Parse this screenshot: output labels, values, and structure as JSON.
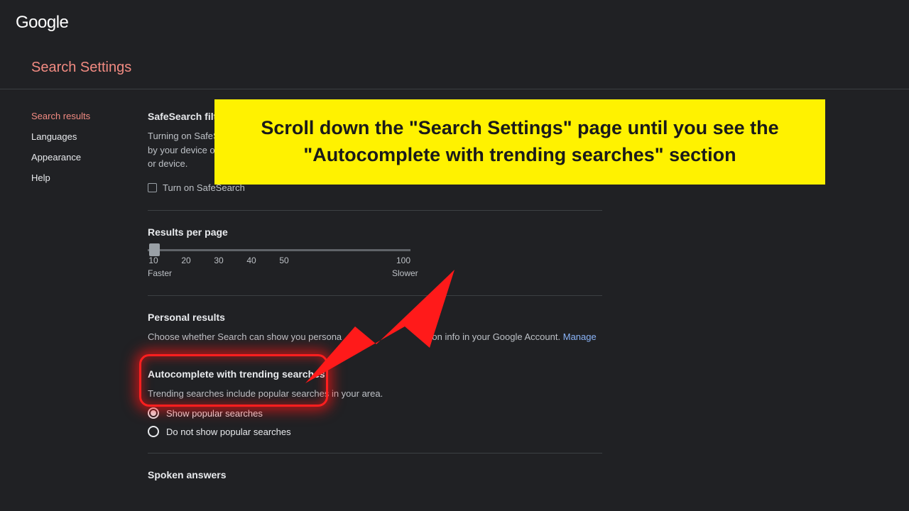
{
  "logo": "Google",
  "page_title": "Search Settings",
  "sidebar": {
    "items": [
      {
        "label": "Search results",
        "active": true
      },
      {
        "label": "Languages",
        "active": false
      },
      {
        "label": "Appearance",
        "active": false
      },
      {
        "label": "Help",
        "active": false
      }
    ]
  },
  "safesearch": {
    "heading": "SafeSearch filters",
    "body_line1": "Turning on SafeSearch helps hide explicit content.",
    "body_line2": "by your device or network administrator.",
    "body_line3": "or device.",
    "checkbox_label": "Turn on SafeSearch"
  },
  "results_per_page": {
    "heading": "Results per page",
    "ticks": [
      "10",
      "20",
      "30",
      "40",
      "50",
      "100"
    ],
    "caption_left": "Faster",
    "caption_right": "Slower"
  },
  "personal": {
    "heading": "Personal results",
    "body_left": "Choose whether Search can show you persona",
    "body_right": "on info in your Google Account.",
    "manage": "Manage"
  },
  "autocomplete": {
    "heading": "Autocomplete with trending searches",
    "body": "Trending searches include popular searches in your area.",
    "option_show": "Show popular searches",
    "option_hide": "Do not show popular searches"
  },
  "spoken": {
    "heading": "Spoken answers"
  },
  "callout": {
    "text": "Scroll down the \"Search Settings\" page until you see the \"Autocomplete with trending searches\" section"
  }
}
